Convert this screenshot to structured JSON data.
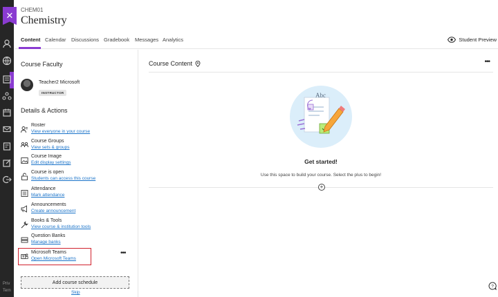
{
  "header": {
    "course_code": "CHEM01",
    "course_title": "Chemistry"
  },
  "tabs": [
    {
      "label": "Content",
      "active": true
    },
    {
      "label": "Calendar"
    },
    {
      "label": "Discussions"
    },
    {
      "label": "Gradebook"
    },
    {
      "label": "Messages"
    },
    {
      "label": "Analytics"
    }
  ],
  "student_preview": "Student Preview",
  "left_panel": {
    "faculty_title": "Course Faculty",
    "faculty_name": "Teacher2 Microsoft",
    "faculty_role": "INSTRUCTOR",
    "details_title": "Details & Actions",
    "actions": [
      {
        "title": "Roster",
        "link": "View everyone in your course",
        "icon": "roster-icon"
      },
      {
        "title": "Course Groups",
        "link": "View sets & groups",
        "icon": "groups-icon"
      },
      {
        "title": "Course Image",
        "link": "Edit display settings",
        "icon": "image-icon"
      },
      {
        "title": "Course is open",
        "link": "Students can access this course",
        "icon": "unlock-icon"
      },
      {
        "title": "Attendance",
        "link": "Mark attendance",
        "icon": "attendance-icon"
      },
      {
        "title": "Announcements",
        "link": "Create announcement",
        "icon": "megaphone-icon"
      },
      {
        "title": "Books & Tools",
        "link": "View course & institution tools",
        "icon": "wrench-icon"
      },
      {
        "title": "Question Banks",
        "link": "Manage banks",
        "icon": "question-bank-icon"
      },
      {
        "title": "Microsoft Teams",
        "link": "Open Microsoft Teams",
        "icon": "teams-icon"
      }
    ],
    "schedule_button": "Add course schedule",
    "skip_link": "Skip"
  },
  "content": {
    "title": "Course Content",
    "empty_title": "Get started!",
    "empty_text": "Use this space to build your course. Select the plus to begin!",
    "add_symbol": "+",
    "more_symbol": "•••"
  },
  "rail": {
    "footer_1": "Priv",
    "footer_2": "Tern"
  },
  "colors": {
    "accent": "#8a3bd1",
    "link": "#1a73c9",
    "highlight": "#d0202c",
    "rail": "#262626"
  }
}
